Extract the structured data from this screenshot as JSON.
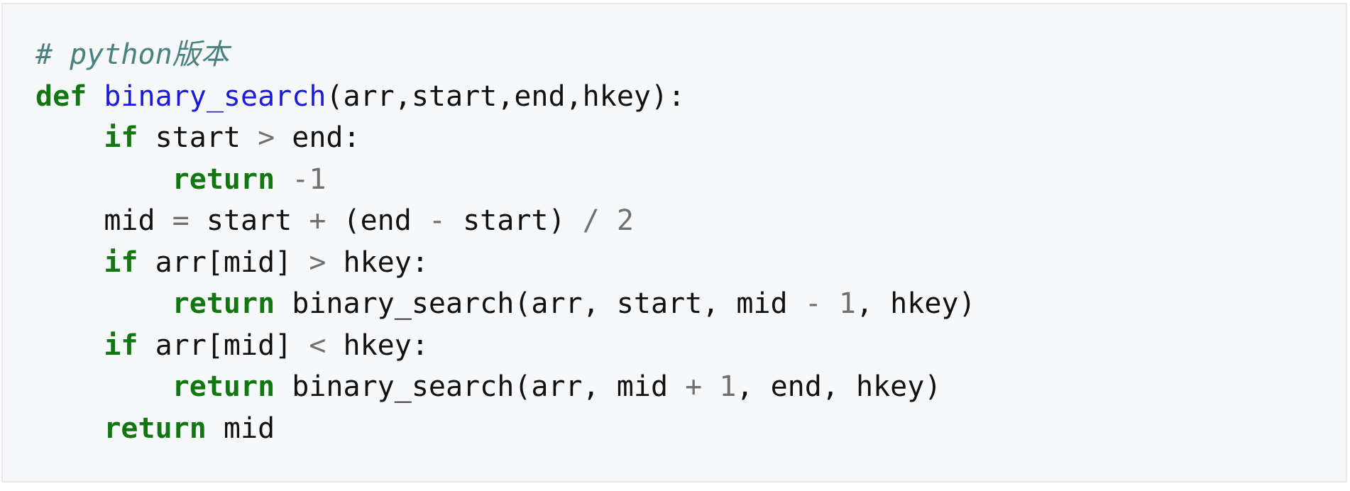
{
  "code": {
    "language": "python",
    "lines": [
      [
        {
          "t": "cm",
          "v": "# python版本"
        }
      ],
      [
        {
          "t": "kw",
          "v": "def"
        },
        {
          "t": "tx",
          "v": " "
        },
        {
          "t": "fn",
          "v": "binary_search"
        },
        {
          "t": "tx",
          "v": "(arr,start,end,hkey):"
        }
      ],
      [
        {
          "t": "tx",
          "v": "    "
        },
        {
          "t": "kw",
          "v": "if"
        },
        {
          "t": "tx",
          "v": " start "
        },
        {
          "t": "op",
          "v": ">"
        },
        {
          "t": "tx",
          "v": " end:"
        }
      ],
      [
        {
          "t": "tx",
          "v": "        "
        },
        {
          "t": "kw",
          "v": "return"
        },
        {
          "t": "tx",
          "v": " "
        },
        {
          "t": "num",
          "v": "-1"
        }
      ],
      [
        {
          "t": "tx",
          "v": "    mid "
        },
        {
          "t": "op",
          "v": "="
        },
        {
          "t": "tx",
          "v": " start "
        },
        {
          "t": "op",
          "v": "+"
        },
        {
          "t": "tx",
          "v": " (end "
        },
        {
          "t": "op",
          "v": "-"
        },
        {
          "t": "tx",
          "v": " start) "
        },
        {
          "t": "op",
          "v": "/"
        },
        {
          "t": "tx",
          "v": " "
        },
        {
          "t": "num",
          "v": "2"
        }
      ],
      [
        {
          "t": "tx",
          "v": "    "
        },
        {
          "t": "kw",
          "v": "if"
        },
        {
          "t": "tx",
          "v": " arr[mid] "
        },
        {
          "t": "op",
          "v": ">"
        },
        {
          "t": "tx",
          "v": " hkey:"
        }
      ],
      [
        {
          "t": "tx",
          "v": "        "
        },
        {
          "t": "kw",
          "v": "return"
        },
        {
          "t": "tx",
          "v": " binary_search(arr, start, mid "
        },
        {
          "t": "op",
          "v": "-"
        },
        {
          "t": "tx",
          "v": " "
        },
        {
          "t": "num",
          "v": "1"
        },
        {
          "t": "tx",
          "v": ", hkey)"
        }
      ],
      [
        {
          "t": "tx",
          "v": "    "
        },
        {
          "t": "kw",
          "v": "if"
        },
        {
          "t": "tx",
          "v": " arr[mid] "
        },
        {
          "t": "op",
          "v": "<"
        },
        {
          "t": "tx",
          "v": " hkey:"
        }
      ],
      [
        {
          "t": "tx",
          "v": "        "
        },
        {
          "t": "kw",
          "v": "return"
        },
        {
          "t": "tx",
          "v": " binary_search(arr, mid "
        },
        {
          "t": "op",
          "v": "+"
        },
        {
          "t": "tx",
          "v": " "
        },
        {
          "t": "num",
          "v": "1"
        },
        {
          "t": "tx",
          "v": ", end, hkey)"
        }
      ],
      [
        {
          "t": "tx",
          "v": "    "
        },
        {
          "t": "kw",
          "v": "return"
        },
        {
          "t": "tx",
          "v": " mid"
        }
      ]
    ]
  },
  "colors": {
    "background": "#f7f8fa",
    "border": "#e6e8eb",
    "comment": "#4a8282",
    "keyword": "#117711",
    "function_name": "#1b1bdd",
    "operator": "#707070",
    "number": "#707070",
    "text": "#111111"
  }
}
